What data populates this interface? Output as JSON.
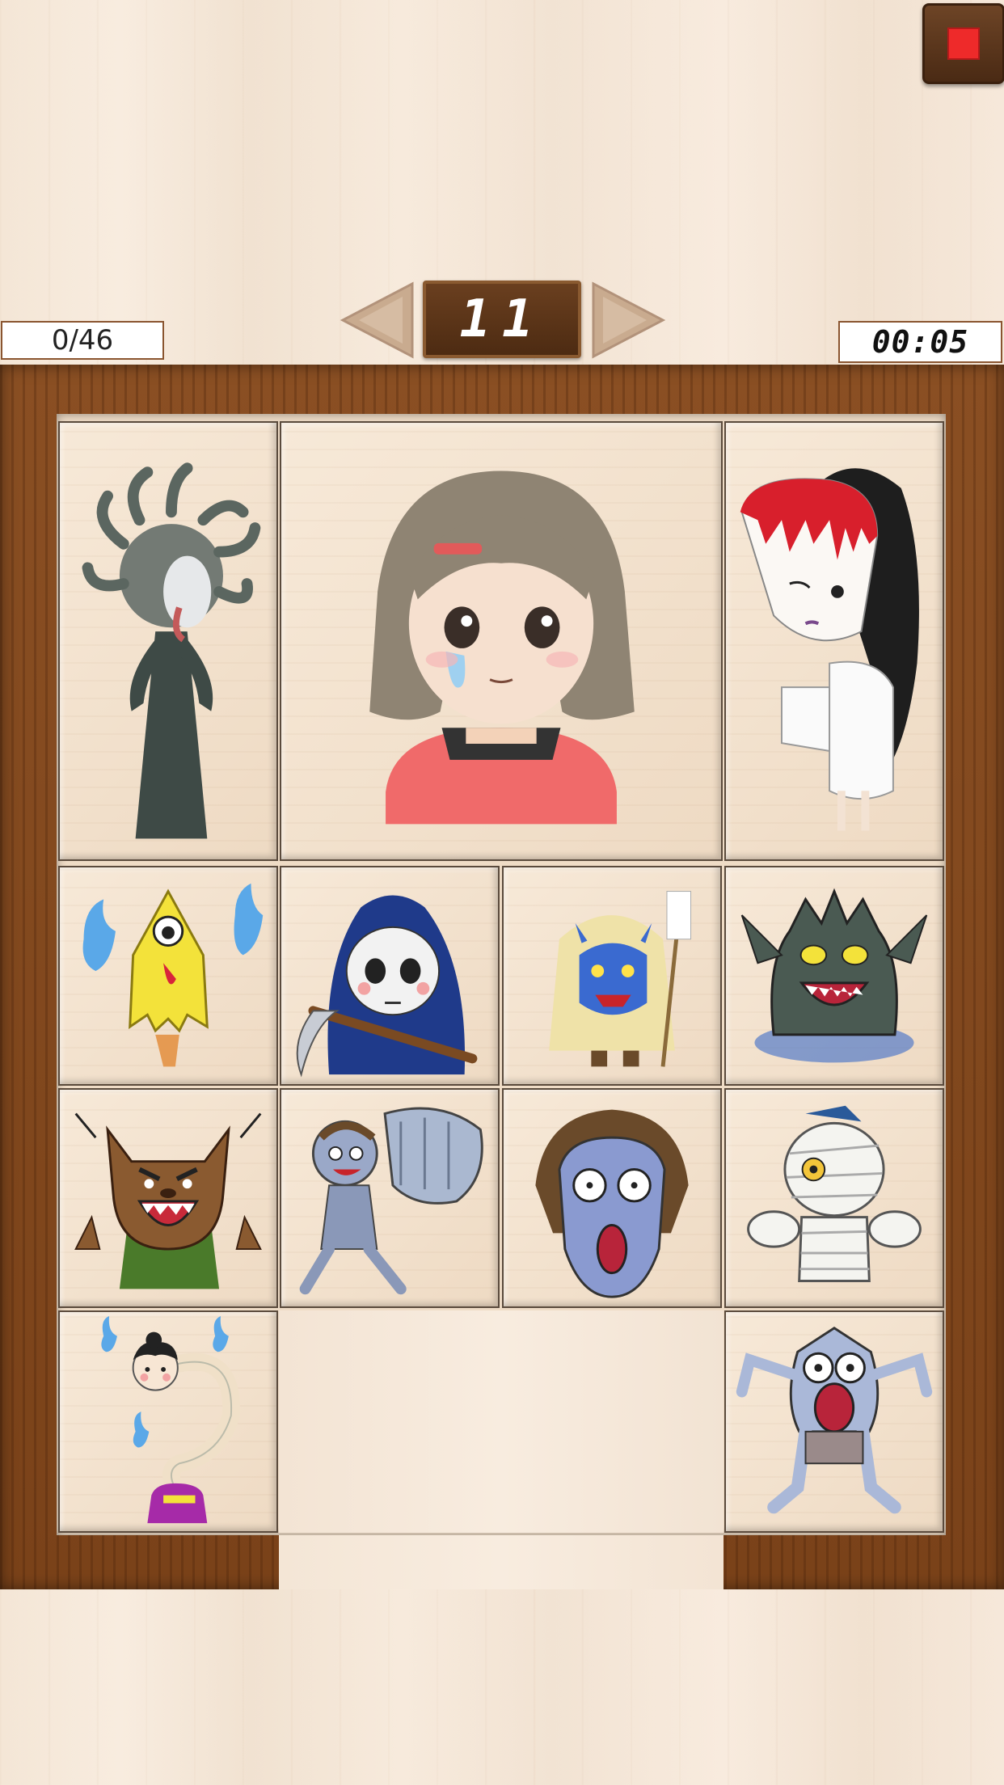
{
  "hud": {
    "moves": "0/46",
    "level": "11",
    "timer": "00:05"
  },
  "icons": {
    "stop": "stop-icon",
    "prev": "arrow-left-icon",
    "next": "arrow-right-icon"
  },
  "colors": {
    "stop_red": "#ee2a2a",
    "frame_wood": "#7a4219",
    "tile_wood": "#f2e2cf"
  },
  "board": {
    "columns": 4,
    "rows": 4,
    "tiles": [
      {
        "id": "medusa",
        "depicts": "medusa-yokai"
      },
      {
        "id": "girl",
        "depicts": "crying-girl"
      },
      {
        "id": "okiku",
        "depicts": "bleeding-ghost-woman"
      },
      {
        "id": "kasa",
        "depicts": "one-eyed-yellow-ghost"
      },
      {
        "id": "reaper",
        "depicts": "grim-reaper"
      },
      {
        "id": "namahage",
        "depicts": "blue-oni-namahage"
      },
      {
        "id": "kappa",
        "depicts": "fish-monster"
      },
      {
        "id": "wolf",
        "depicts": "werewolf"
      },
      {
        "id": "zombie",
        "depicts": "zombie-fist"
      },
      {
        "id": "screamer",
        "depicts": "screaming-ghoul"
      },
      {
        "id": "mummy",
        "depicts": "mummy"
      },
      {
        "id": "rokuro",
        "depicts": "rokurokubi"
      },
      {
        "id": "gremlin",
        "depicts": "screaming-gremlin"
      }
    ]
  }
}
